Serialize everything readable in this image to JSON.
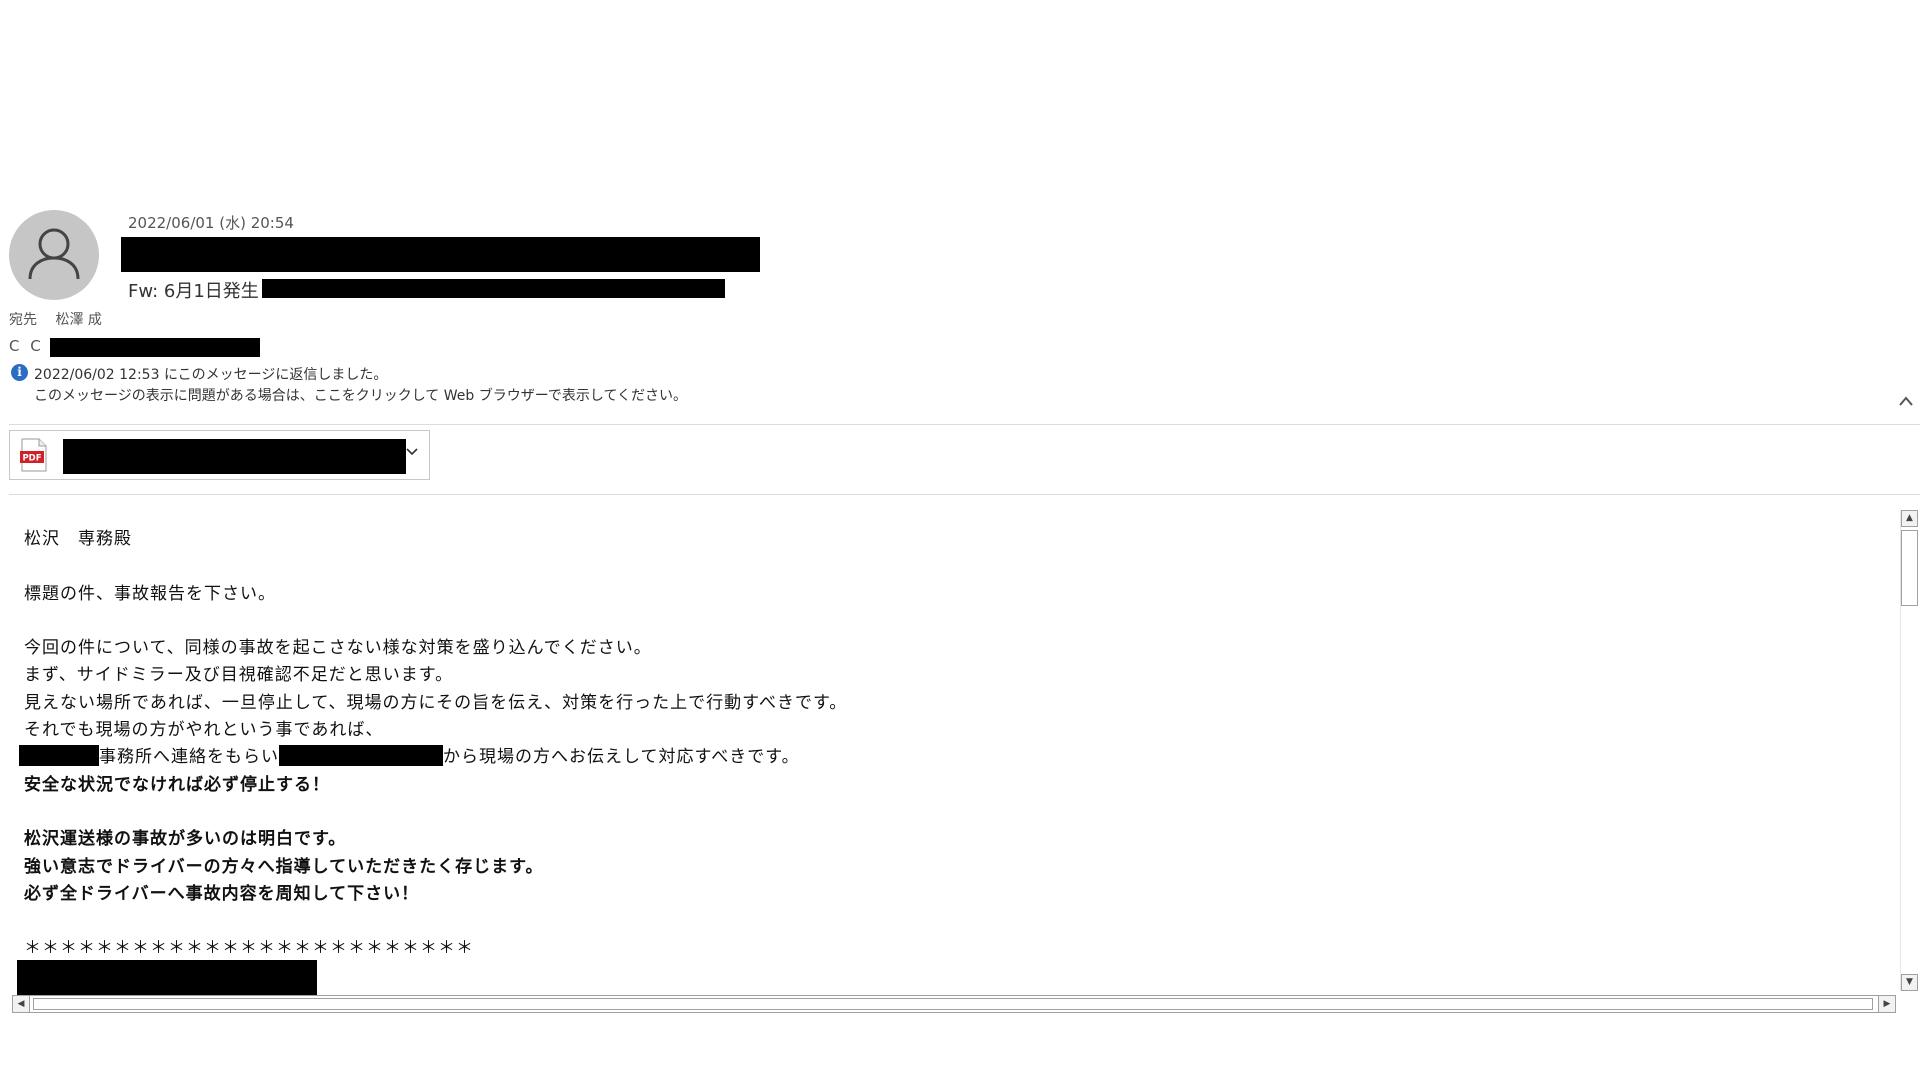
{
  "header": {
    "date": "2022/06/01 (水) 20:54",
    "subject": "Fw: 6月1日発生",
    "to_label": "宛先",
    "to_name": "松澤 成",
    "cc_label": "C C"
  },
  "info": {
    "reply_notice": "2022/06/02 12:53 にこのメッセージに返信しました。",
    "display_notice": "このメッセージの表示に問題がある場合は、ここをクリックして Web ブラウザーで表示してください。"
  },
  "attachment": {
    "icon_label": "PDF"
  },
  "body": {
    "l1": "松沢　専務殿",
    "l2": "標題の件、事故報告を下さい。",
    "l3": "今回の件について、同様の事故を起こさない様な対策を盛り込んでください。",
    "l4": "まず、サイドミラー及び目視確認不足だと思います。",
    "l5": "見えない場所であれば、一旦停止して、現場の方にその旨を伝え、対策を行った上で行動すべきです。",
    "l6": "それでも現場の方がやれという事であれば、",
    "l7a": "事務所へ連絡をもらい",
    "l7b": "から現場の方へお伝えして対応すべきです。",
    "l8": "安全な状況でなければ必ず停止する！",
    "l9": "松沢運送様の事故が多いのは明白です。",
    "l10": "強い意志でドライバーの方々へ指導していただきたく存じます。",
    "l11": "必ず全ドライバーへ事故内容を周知して下さい！",
    "l12": "＊＊＊＊＊＊＊＊＊＊＊＊＊＊＊＊＊＊＊＊＊＊＊＊＊"
  },
  "icons": {
    "avatar": "person-icon",
    "info": "info-icon",
    "collapse": "chevron-up-icon",
    "attachment": "pdf-file-icon",
    "attachment_menu": "chevron-down-icon"
  },
  "colors": {
    "info_blue": "#2b6cc4",
    "pdf_red": "#d0202a",
    "redaction": "#000000"
  }
}
